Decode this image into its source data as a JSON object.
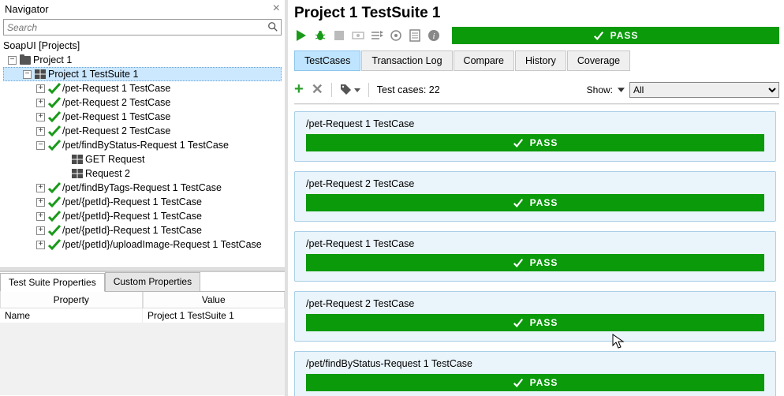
{
  "navigator": {
    "title": "Navigator",
    "search_placeholder": "Search",
    "root": "SoapUI [Projects]",
    "project": "Project 1",
    "suite": "Project 1 TestSuite 1",
    "nodes": [
      "/pet-Request 1 TestCase",
      "/pet-Request 2 TestCase",
      "/pet-Request 1 TestCase",
      "/pet-Request 2 TestCase",
      "/pet/findByStatus-Request 1 TestCase"
    ],
    "requests": [
      "GET Request",
      "Request 2"
    ],
    "after_requests": [
      "/pet/findByTags-Request 1 TestCase",
      "/pet/{petId}-Request 1 TestCase",
      "/pet/{petId}-Request 1 TestCase",
      "/pet/{petId}-Request 1 TestCase",
      "/pet/{petId}/uploadImage-Request 1 TestCase"
    ]
  },
  "props": {
    "tab1": "Test Suite Properties",
    "tab2": "Custom Properties",
    "col1": "Property",
    "col2": "Value",
    "row_name": "Name",
    "row_value": "Project 1 TestSuite 1"
  },
  "right": {
    "title": "Project 1 TestSuite 1",
    "pass": "PASS",
    "tabs": [
      "TestCases",
      "Transaction Log",
      "Compare",
      "History",
      "Coverage"
    ],
    "count_label": "Test cases: 22",
    "show_label": "Show:",
    "show_value": "All",
    "cases": [
      {
        "name": "/pet-Request 1 TestCase"
      },
      {
        "name": "/pet-Request 2 TestCase"
      },
      {
        "name": "/pet-Request 1 TestCase"
      },
      {
        "name": "/pet-Request 2 TestCase"
      },
      {
        "name": "/pet/findByStatus-Request 1 TestCase"
      }
    ]
  }
}
